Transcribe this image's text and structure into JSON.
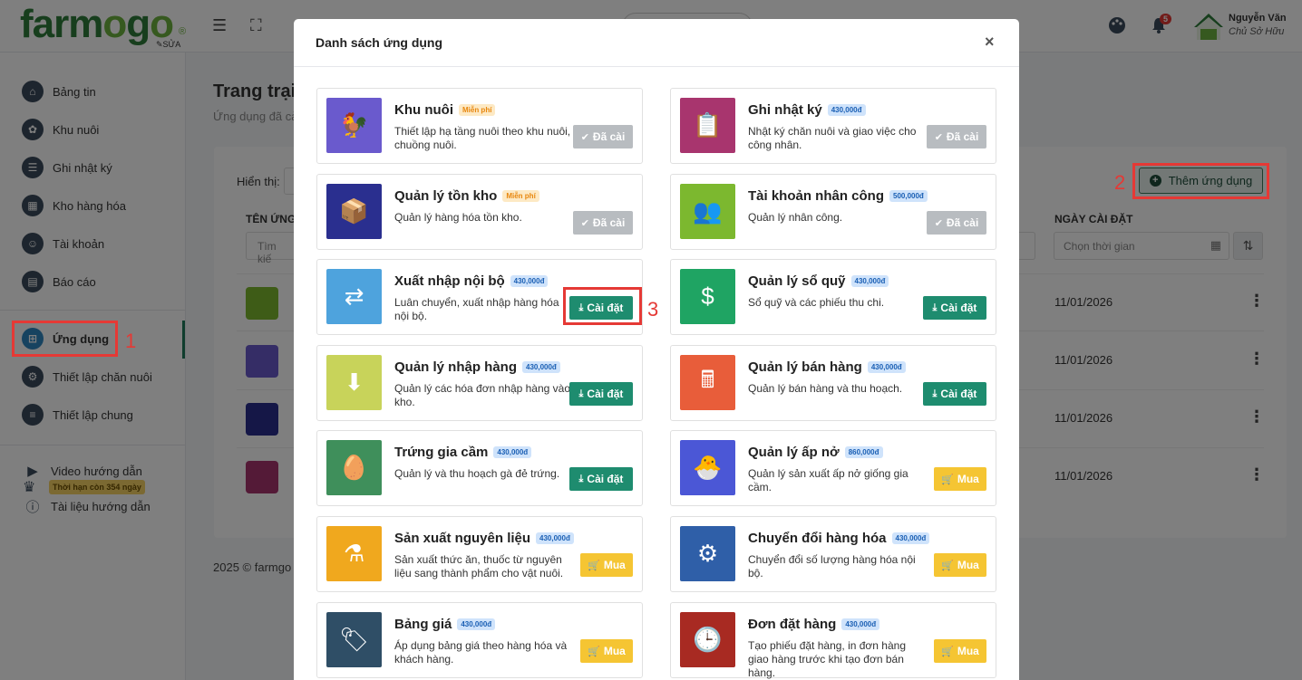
{
  "brand": {
    "logo_a": "farm",
    "logo_o": "o",
    "logo_b": "g",
    "logo_c": "o",
    "reg": "®",
    "edit_label": "SỬA"
  },
  "topbar": {
    "notif_count": "5",
    "user_name": "Nguyễn Văn",
    "user_role": "Chủ Sở Hữu"
  },
  "sidebar": {
    "items": [
      {
        "label": "Bảng tin",
        "icon": "home-icon"
      },
      {
        "label": "Khu nuôi",
        "icon": "livestock-icon"
      },
      {
        "label": "Ghi nhật ký",
        "icon": "diary-icon"
      },
      {
        "label": "Kho hàng hóa",
        "icon": "warehouse-icon"
      },
      {
        "label": "Tài khoản",
        "icon": "users-icon"
      },
      {
        "label": "Báo cáo",
        "icon": "report-icon"
      },
      {
        "label": "Ứng dụng",
        "icon": "apps-icon"
      },
      {
        "label": "Thiết lập chăn nuôi",
        "icon": "gear-icon"
      },
      {
        "label": "Thiết lập chung",
        "icon": "sliders-icon"
      }
    ],
    "links": [
      {
        "label": "Video hướng dẫn",
        "icon": "youtube-icon"
      },
      {
        "label": "Tài liệu hướng dẫn",
        "icon": "info-icon"
      }
    ],
    "expiry": "Thời hạn còn 354 ngày"
  },
  "annotations": {
    "n1": "1",
    "n2": "2",
    "n3": "3"
  },
  "main": {
    "title": "Trang trại",
    "subtitle": "Ứng dụng đã cà",
    "show_label": "Hiển thị:",
    "col_name": "TÊN ỨNG",
    "col_date": "NGÀY CÀI ĐẶT",
    "search_placeholder": "Tìm kiế",
    "date_placeholder": "Chọn thời gian",
    "add_button": "Thêm ứng dụng",
    "rows": [
      {
        "date": "11/01/2026",
        "color": "#7cb82f"
      },
      {
        "date": "11/01/2026",
        "color": "#6a5acd"
      },
      {
        "date": "11/01/2026",
        "color": "#2a2f8f"
      },
      {
        "date": "11/01/2026",
        "color": "#a8356e"
      }
    ],
    "footer": "2025 © farmgo"
  },
  "modal": {
    "title": "Danh sách ứng dụng",
    "close": "×",
    "apps": [
      {
        "name": "Khu nuôi",
        "price": "Miễn phí",
        "free": true,
        "desc": "Thiết lập hạ tầng nuôi theo khu nuôi, chuồng nuôi.",
        "action": "Đã cài",
        "state": "installed",
        "color": "#6a5acd",
        "glyph": "🐓"
      },
      {
        "name": "Ghi nhật ký",
        "price": "430,000đ",
        "free": false,
        "desc": "Nhật ký chăn nuôi và giao việc cho công nhân.",
        "action": "Đã cài",
        "state": "installed",
        "color": "#a8356e",
        "glyph": "📋"
      },
      {
        "name": "Quản lý tồn kho",
        "price": "Miễn phí",
        "free": true,
        "desc": "Quản lý hàng hóa tồn kho.",
        "action": "Đã cài",
        "state": "installed",
        "color": "#2a2f8f",
        "glyph": "📦"
      },
      {
        "name": "Tài khoản nhân công",
        "price": "500,000đ",
        "free": false,
        "desc": "Quản lý nhân công.",
        "action": "Đã cài",
        "state": "installed",
        "color": "#7cb82f",
        "glyph": "👥"
      },
      {
        "name": "Xuất nhập nội bộ",
        "price": "430,000đ",
        "free": false,
        "desc": "Luân chuyển, xuất nhập hàng hóa nội bộ.",
        "action": "Cài đặt",
        "state": "install",
        "color": "#4ea3dd",
        "glyph": "⇄"
      },
      {
        "name": "Quản lý sổ quỹ",
        "price": "430,000đ",
        "free": false,
        "desc": "Sổ quỹ và các phiếu thu chi.",
        "action": "Cài đặt",
        "state": "install",
        "color": "#1fa463",
        "glyph": "$"
      },
      {
        "name": "Quản lý nhập hàng",
        "price": "430,000đ",
        "free": false,
        "desc": "Quản lý các hóa đơn nhập hàng vào kho.",
        "action": "Cài đặt",
        "state": "install",
        "color": "#c8d35a",
        "glyph": "⬇"
      },
      {
        "name": "Quản lý bán hàng",
        "price": "430,000đ",
        "free": false,
        "desc": "Quản lý bán hàng và thu hoạch.",
        "action": "Cài đặt",
        "state": "install",
        "color": "#e85d3a",
        "glyph": "🖩"
      },
      {
        "name": "Trứng gia cầm",
        "price": "430,000đ",
        "free": false,
        "desc": "Quản lý và thu hoạch gà đẻ trứng.",
        "action": "Cài đặt",
        "state": "install",
        "color": "#3f8f5b",
        "glyph": "🥚"
      },
      {
        "name": "Quản lý ấp nở",
        "price": "860,000đ",
        "free": false,
        "desc": "Quản lý sản xuất ấp nở giống gia cầm.",
        "action": "Mua",
        "state": "buy",
        "color": "#4b57d6",
        "glyph": "🐣"
      },
      {
        "name": "Sản xuất nguyên liệu",
        "price": "430,000đ",
        "free": false,
        "desc": "Sản xuất thức ăn, thuốc từ nguyên liệu sang thành phẩm cho vật nuôi.",
        "action": "Mua",
        "state": "buy",
        "color": "#f0a81e",
        "glyph": "⚗"
      },
      {
        "name": "Chuyển đổi hàng hóa",
        "price": "430,000đ",
        "free": false,
        "desc": "Chuyển đổi số lượng hàng hóa nội bộ.",
        "action": "Mua",
        "state": "buy",
        "color": "#2f5fa8",
        "glyph": "⚙"
      },
      {
        "name": "Bảng giá",
        "price": "430,000đ",
        "free": false,
        "desc": "Áp dụng bảng giá theo hàng hóa và khách hàng.",
        "action": "Mua",
        "state": "buy",
        "color": "#2f4e66",
        "glyph": "🏷"
      },
      {
        "name": "Đơn đặt hàng",
        "price": "430,000đ",
        "free": false,
        "desc": "Tạo phiếu đặt hàng, in đơn hàng giao hàng trước khi tạo đơn bán hàng.",
        "action": "Mua",
        "state": "buy",
        "color": "#a82a22",
        "glyph": "🕒"
      }
    ]
  }
}
